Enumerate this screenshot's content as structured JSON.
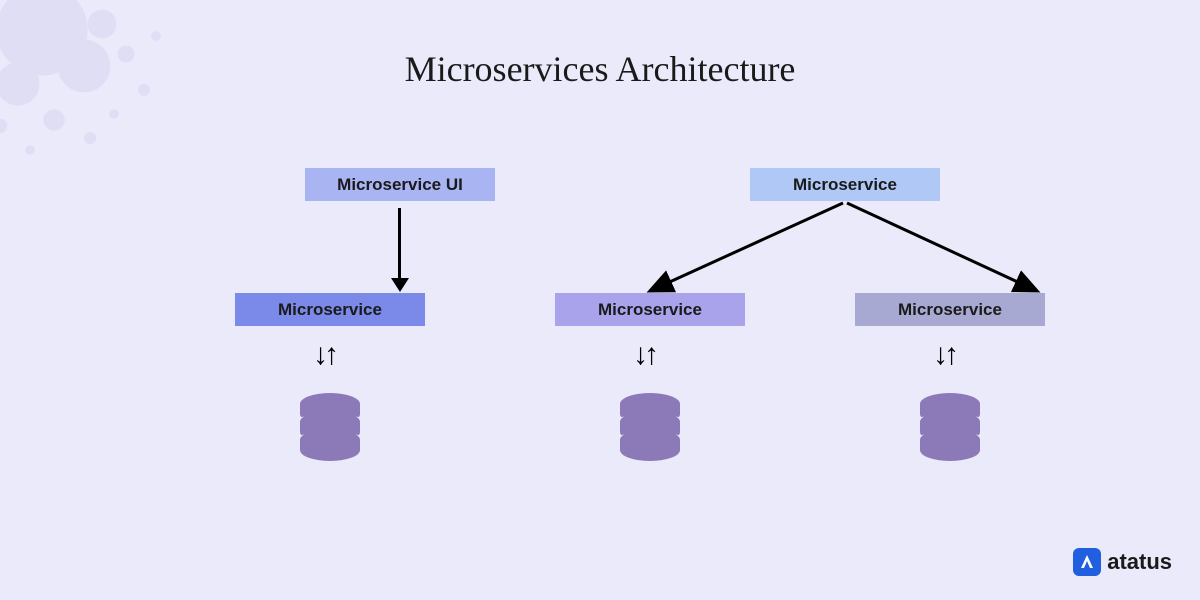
{
  "title": "Microservices Architecture",
  "boxes": {
    "ui": "Microservice UI",
    "top_right": "Microservice",
    "ms1": "Microservice",
    "ms2": "Microservice",
    "ms3": "Microservice"
  },
  "logo": {
    "text": "atatus"
  },
  "colors": {
    "background": "#eaeafa",
    "box_ui": "#a9b4f2",
    "box_top_right": "#afc8f5",
    "box_ms1": "#7b8ae8",
    "box_ms2": "#a9a3ec",
    "box_ms3": "#a8a9d2",
    "db_fill": "#8b79b8",
    "logo_bg": "#1f5fe0"
  }
}
